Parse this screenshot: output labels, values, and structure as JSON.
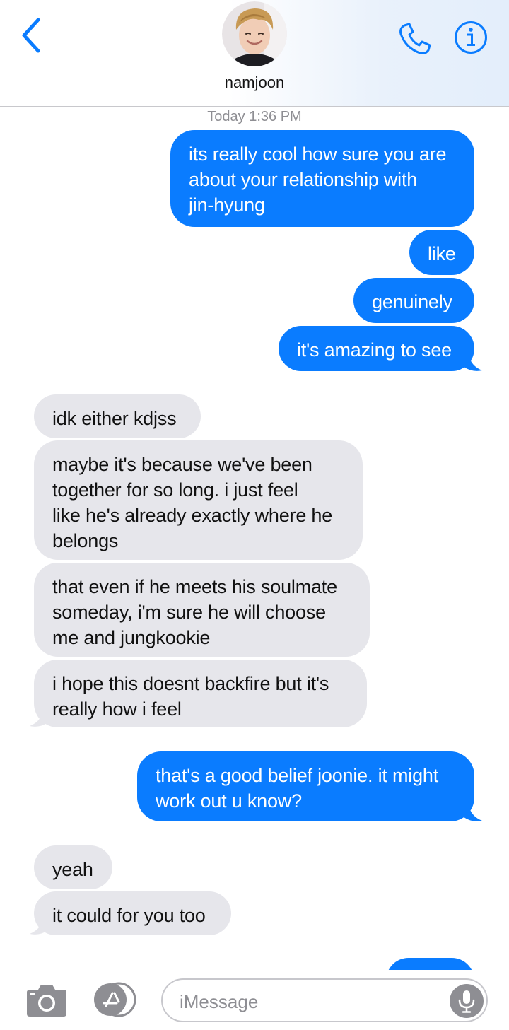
{
  "header": {
    "contact_name": "namjoon",
    "back_icon": "chevron-left-icon",
    "call_icon": "phone-icon",
    "info_icon": "info-icon"
  },
  "conversation": {
    "timestamp": "Today 1:36 PM",
    "messages": [
      {
        "from": "me",
        "text": "its really cool how sure you are\nabout your relationship with\njin-hyung"
      },
      {
        "from": "me",
        "text": "like"
      },
      {
        "from": "me",
        "text": "genuinely"
      },
      {
        "from": "me",
        "text": "it's amazing to see"
      },
      {
        "from": "them",
        "text": "idk either kdjss"
      },
      {
        "from": "them",
        "text": "maybe it's because we've been\ntogether for so long. i just feel\nlike he's already exactly where he\nbelongs"
      },
      {
        "from": "them",
        "text": "that even if he meets his soulmate\nsomeday, i'm sure he will choose\nme and jungkookie"
      },
      {
        "from": "them",
        "text": "i hope this doesnt backfire but it's\nreally how i feel"
      },
      {
        "from": "me",
        "text": "that's a good belief joonie. it might\nwork out u know?"
      },
      {
        "from": "them",
        "text": "yeah"
      },
      {
        "from": "them",
        "text": "it could for you too"
      }
    ]
  },
  "input_bar": {
    "placeholder": "iMessage",
    "camera_icon": "camera-icon",
    "apps_icon": "app-store-icon",
    "mic_icon": "microphone-icon"
  },
  "colors": {
    "accent": "#0a7cff",
    "sent_bubble": "#0a7cff",
    "received_bubble": "#e6e6eb"
  }
}
